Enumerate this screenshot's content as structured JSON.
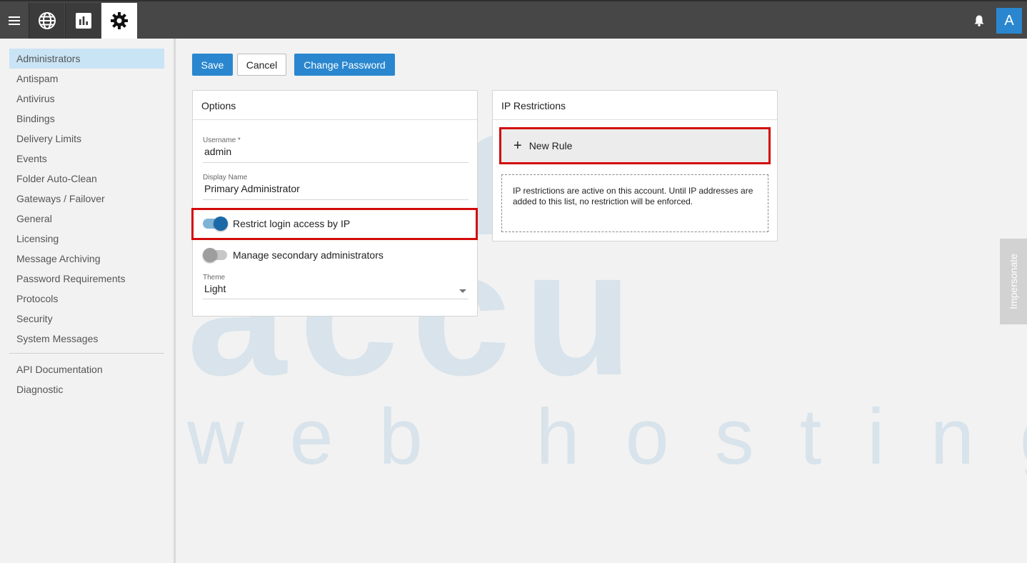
{
  "topbar": {
    "icons": [
      "menu-icon",
      "globe-icon",
      "chart-icon",
      "gear-icon",
      "bell-icon"
    ],
    "avatar_letter": "A",
    "colors": {
      "bar": "#474747",
      "accent": "#2a87cf"
    }
  },
  "sidebar": {
    "items": [
      {
        "label": "Administrators",
        "active": true
      },
      {
        "label": "Antispam"
      },
      {
        "label": "Antivirus"
      },
      {
        "label": "Bindings"
      },
      {
        "label": "Delivery Limits"
      },
      {
        "label": "Events"
      },
      {
        "label": "Folder Auto-Clean"
      },
      {
        "label": "Gateways / Failover"
      },
      {
        "label": "General"
      },
      {
        "label": "Licensing"
      },
      {
        "label": "Message Archiving"
      },
      {
        "label": "Password Requirements"
      },
      {
        "label": "Protocols"
      },
      {
        "label": "Security"
      },
      {
        "label": "System Messages"
      }
    ],
    "secondary_items": [
      {
        "label": "API Documentation"
      },
      {
        "label": "Diagnostic"
      }
    ]
  },
  "toolbar": {
    "save_label": "Save",
    "cancel_label": "Cancel",
    "change_password_label": "Change Password"
  },
  "options": {
    "title": "Options",
    "username_label": "Username *",
    "username_value": "admin",
    "display_name_label": "Display Name",
    "display_name_value": "Primary Administrator",
    "restrict_ip_label": "Restrict login access by IP",
    "restrict_ip_on": true,
    "manage_secondary_label": "Manage secondary administrators",
    "manage_secondary_on": false,
    "theme_label": "Theme",
    "theme_value": "Light"
  },
  "ip_restrictions": {
    "title": "IP Restrictions",
    "new_rule_label": "New Rule",
    "note": "IP restrictions are active on this account. Until IP addresses are added to this list, no restriction will be enforced."
  },
  "impersonate_label": "Impersonate",
  "watermark": {
    "line1": "accu",
    "line2": "web hosting"
  }
}
